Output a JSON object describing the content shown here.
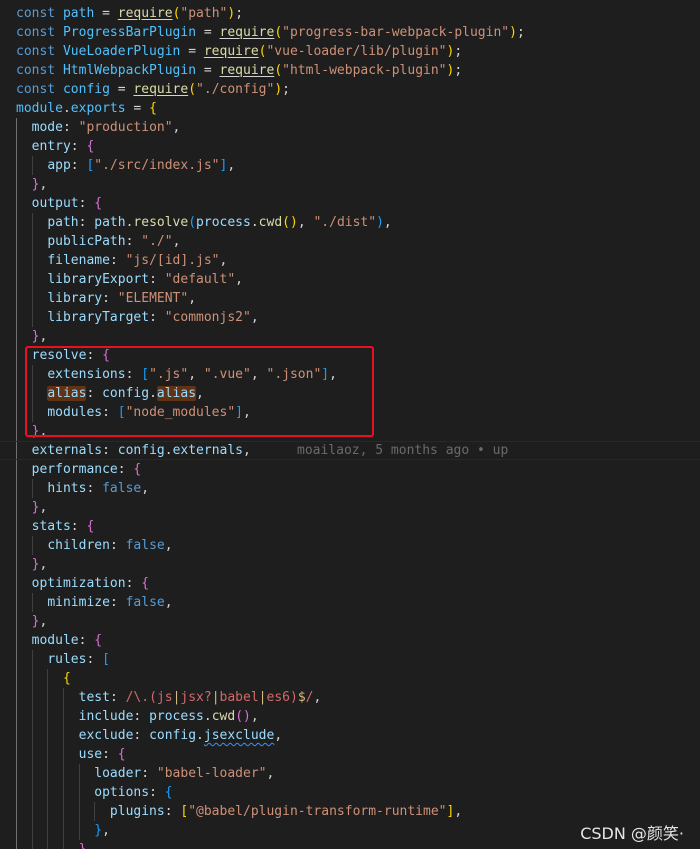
{
  "editor": {
    "lines": [
      [
        [
          "kw",
          "const"
        ],
        [
          "punc",
          " "
        ],
        [
          "var",
          "path"
        ],
        [
          "punc",
          " = "
        ],
        [
          "fnu",
          "require"
        ],
        [
          "b1",
          "("
        ],
        [
          "str",
          "\"path\""
        ],
        [
          "b1",
          ")"
        ],
        [
          "punc",
          ";"
        ]
      ],
      [
        [
          "kw",
          "const"
        ],
        [
          "punc",
          " "
        ],
        [
          "var",
          "ProgressBarPlugin"
        ],
        [
          "punc",
          " = "
        ],
        [
          "fnu",
          "require"
        ],
        [
          "b1",
          "("
        ],
        [
          "str",
          "\"progress-bar-webpack-plugin\""
        ],
        [
          "b1",
          ")"
        ],
        [
          "punc",
          ";"
        ]
      ],
      [
        [
          "kw",
          "const"
        ],
        [
          "punc",
          " "
        ],
        [
          "var",
          "VueLoaderPlugin"
        ],
        [
          "punc",
          " = "
        ],
        [
          "fnu",
          "require"
        ],
        [
          "b1",
          "("
        ],
        [
          "str",
          "\"vue-loader/lib/plugin\""
        ],
        [
          "b1",
          ")"
        ],
        [
          "punc",
          ";"
        ]
      ],
      [
        [
          "kw",
          "const"
        ],
        [
          "punc",
          " "
        ],
        [
          "var",
          "HtmlWebpackPlugin"
        ],
        [
          "punc",
          " = "
        ],
        [
          "fnu",
          "require"
        ],
        [
          "b1",
          "("
        ],
        [
          "str",
          "\"html-webpack-plugin\""
        ],
        [
          "b1",
          ")"
        ],
        [
          "punc",
          ";"
        ]
      ],
      [
        [
          "kw",
          "const"
        ],
        [
          "punc",
          " "
        ],
        [
          "var",
          "config"
        ],
        [
          "punc",
          " = "
        ],
        [
          "fnu",
          "require"
        ],
        [
          "b1",
          "("
        ],
        [
          "str",
          "\"./config\""
        ],
        [
          "b1",
          ")"
        ],
        [
          "punc",
          ";"
        ]
      ],
      [
        [
          "var",
          "module"
        ],
        [
          "punc",
          "."
        ],
        [
          "var",
          "exports"
        ],
        [
          "punc",
          " = "
        ],
        [
          "b1",
          "{"
        ]
      ],
      [
        [
          "punc",
          "  "
        ],
        [
          "prop",
          "mode"
        ],
        [
          "punc",
          ": "
        ],
        [
          "str",
          "\"production\""
        ],
        [
          "punc",
          ","
        ]
      ],
      [
        [
          "punc",
          "  "
        ],
        [
          "prop",
          "entry"
        ],
        [
          "punc",
          ": "
        ],
        [
          "b2",
          "{"
        ]
      ],
      [
        [
          "punc",
          "    "
        ],
        [
          "prop",
          "app"
        ],
        [
          "punc",
          ": "
        ],
        [
          "b3",
          "["
        ],
        [
          "str",
          "\"./src/index.js\""
        ],
        [
          "b3",
          "]"
        ],
        [
          "punc",
          ","
        ]
      ],
      [
        [
          "punc",
          "  "
        ],
        [
          "b2",
          "}"
        ],
        [
          "punc",
          ","
        ]
      ],
      [
        [
          "punc",
          "  "
        ],
        [
          "prop",
          "output"
        ],
        [
          "punc",
          ": "
        ],
        [
          "b2",
          "{"
        ]
      ],
      [
        [
          "punc",
          "    "
        ],
        [
          "prop",
          "path"
        ],
        [
          "punc",
          ": "
        ],
        [
          "prop",
          "path"
        ],
        [
          "punc",
          "."
        ],
        [
          "fn",
          "resolve"
        ],
        [
          "b3",
          "("
        ],
        [
          "prop",
          "process"
        ],
        [
          "punc",
          "."
        ],
        [
          "fn",
          "cwd"
        ],
        [
          "b1",
          "()"
        ],
        [
          "punc",
          ", "
        ],
        [
          "str",
          "\"./dist\""
        ],
        [
          "b3",
          ")"
        ],
        [
          "punc",
          ","
        ]
      ],
      [
        [
          "punc",
          "    "
        ],
        [
          "prop",
          "publicPath"
        ],
        [
          "punc",
          ": "
        ],
        [
          "str",
          "\"./\""
        ],
        [
          "punc",
          ","
        ]
      ],
      [
        [
          "punc",
          "    "
        ],
        [
          "prop",
          "filename"
        ],
        [
          "punc",
          ": "
        ],
        [
          "str",
          "\"js/[id].js\""
        ],
        [
          "punc",
          ","
        ]
      ],
      [
        [
          "punc",
          "    "
        ],
        [
          "prop",
          "libraryExport"
        ],
        [
          "punc",
          ": "
        ],
        [
          "str",
          "\"default\""
        ],
        [
          "punc",
          ","
        ]
      ],
      [
        [
          "punc",
          "    "
        ],
        [
          "prop",
          "library"
        ],
        [
          "punc",
          ": "
        ],
        [
          "str",
          "\"ELEMENT\""
        ],
        [
          "punc",
          ","
        ]
      ],
      [
        [
          "punc",
          "    "
        ],
        [
          "prop",
          "libraryTarget"
        ],
        [
          "punc",
          ": "
        ],
        [
          "str",
          "\"commonjs2\""
        ],
        [
          "punc",
          ","
        ]
      ],
      [
        [
          "punc",
          "  "
        ],
        [
          "b2",
          "}"
        ],
        [
          "punc",
          ","
        ]
      ],
      [
        [
          "punc",
          "  "
        ],
        [
          "prop",
          "resolve"
        ],
        [
          "punc",
          ": "
        ],
        [
          "b2",
          "{"
        ]
      ],
      [
        [
          "punc",
          "    "
        ],
        [
          "prop",
          "extensions"
        ],
        [
          "punc",
          ": "
        ],
        [
          "b3",
          "["
        ],
        [
          "str",
          "\".js\""
        ],
        [
          "punc",
          ", "
        ],
        [
          "str",
          "\".vue\""
        ],
        [
          "punc",
          ", "
        ],
        [
          "str",
          "\".json\""
        ],
        [
          "b3",
          "]"
        ],
        [
          "punc",
          ","
        ]
      ],
      [
        [
          "punc",
          "    "
        ],
        [
          "prophl",
          "alias"
        ],
        [
          "punc",
          ": "
        ],
        [
          "prop",
          "config"
        ],
        [
          "punc",
          "."
        ],
        [
          "prophl",
          "alias"
        ],
        [
          "punc",
          ","
        ]
      ],
      [
        [
          "punc",
          "    "
        ],
        [
          "prop",
          "modules"
        ],
        [
          "punc",
          ": "
        ],
        [
          "b3",
          "["
        ],
        [
          "str",
          "\"node_modules\""
        ],
        [
          "b3",
          "]"
        ],
        [
          "punc",
          ","
        ]
      ],
      [
        [
          "punc",
          "  "
        ],
        [
          "b2",
          "}"
        ],
        [
          "punc",
          ","
        ]
      ],
      [
        [
          "punc",
          "  "
        ],
        [
          "prop",
          "externals"
        ],
        [
          "punc",
          ": "
        ],
        [
          "prop",
          "config"
        ],
        [
          "punc",
          "."
        ],
        [
          "prop",
          "externals"
        ],
        [
          "punc",
          ","
        ]
      ],
      [
        [
          "punc",
          "  "
        ],
        [
          "prop",
          "performance"
        ],
        [
          "punc",
          ": "
        ],
        [
          "b2",
          "{"
        ]
      ],
      [
        [
          "punc",
          "    "
        ],
        [
          "prop",
          "hints"
        ],
        [
          "punc",
          ": "
        ],
        [
          "bool",
          "false"
        ],
        [
          "punc",
          ","
        ]
      ],
      [
        [
          "punc",
          "  "
        ],
        [
          "b2",
          "}"
        ],
        [
          "punc",
          ","
        ]
      ],
      [
        [
          "punc",
          "  "
        ],
        [
          "prop",
          "stats"
        ],
        [
          "punc",
          ": "
        ],
        [
          "b2",
          "{"
        ]
      ],
      [
        [
          "punc",
          "    "
        ],
        [
          "prop",
          "children"
        ],
        [
          "punc",
          ": "
        ],
        [
          "bool",
          "false"
        ],
        [
          "punc",
          ","
        ]
      ],
      [
        [
          "punc",
          "  "
        ],
        [
          "b2",
          "}"
        ],
        [
          "punc",
          ","
        ]
      ],
      [
        [
          "punc",
          "  "
        ],
        [
          "prop",
          "optimization"
        ],
        [
          "punc",
          ": "
        ],
        [
          "b2",
          "{"
        ]
      ],
      [
        [
          "punc",
          "    "
        ],
        [
          "prop",
          "minimize"
        ],
        [
          "punc",
          ": "
        ],
        [
          "bool",
          "false"
        ],
        [
          "punc",
          ","
        ]
      ],
      [
        [
          "punc",
          "  "
        ],
        [
          "b2",
          "}"
        ],
        [
          "punc",
          ","
        ]
      ],
      [
        [
          "punc",
          "  "
        ],
        [
          "prop",
          "module"
        ],
        [
          "punc",
          ": "
        ],
        [
          "b2",
          "{"
        ]
      ],
      [
        [
          "punc",
          "    "
        ],
        [
          "prop",
          "rules"
        ],
        [
          "punc",
          ": "
        ],
        [
          "b3",
          "["
        ]
      ],
      [
        [
          "punc",
          "      "
        ],
        [
          "b1",
          "{"
        ]
      ],
      [
        [
          "punc",
          "        "
        ],
        [
          "prop",
          "test"
        ],
        [
          "punc",
          ": "
        ],
        [
          "re",
          "/\\.(js"
        ],
        [
          "rd",
          "|"
        ],
        [
          "re",
          "jsx?"
        ],
        [
          "rd",
          "|"
        ],
        [
          "re",
          "babel"
        ],
        [
          "rd",
          "|"
        ],
        [
          "re",
          "es6)"
        ],
        [
          "rd",
          "$"
        ],
        [
          "re",
          "/"
        ],
        [
          "punc",
          ","
        ]
      ],
      [
        [
          "punc",
          "        "
        ],
        [
          "prop",
          "include"
        ],
        [
          "punc",
          ": "
        ],
        [
          "prop",
          "process"
        ],
        [
          "punc",
          "."
        ],
        [
          "fn",
          "cwd"
        ],
        [
          "b2",
          "()"
        ],
        [
          "punc",
          ","
        ]
      ],
      [
        [
          "punc",
          "        "
        ],
        [
          "prop",
          "exclude"
        ],
        [
          "punc",
          ": "
        ],
        [
          "prop",
          "config"
        ],
        [
          "punc",
          "."
        ],
        [
          "propsq",
          "jsexclude"
        ],
        [
          "punc",
          ","
        ]
      ],
      [
        [
          "punc",
          "        "
        ],
        [
          "prop",
          "use"
        ],
        [
          "punc",
          ": "
        ],
        [
          "b2",
          "{"
        ]
      ],
      [
        [
          "punc",
          "          "
        ],
        [
          "prop",
          "loader"
        ],
        [
          "punc",
          ": "
        ],
        [
          "str",
          "\"babel-loader\""
        ],
        [
          "punc",
          ","
        ]
      ],
      [
        [
          "punc",
          "          "
        ],
        [
          "prop",
          "options"
        ],
        [
          "punc",
          ": "
        ],
        [
          "b3",
          "{"
        ]
      ],
      [
        [
          "punc",
          "            "
        ],
        [
          "prop",
          "plugins"
        ],
        [
          "punc",
          ": "
        ],
        [
          "b1",
          "["
        ],
        [
          "str",
          "\"@babel/plugin-transform-runtime\""
        ],
        [
          "b1",
          "]"
        ],
        [
          "punc",
          ","
        ]
      ],
      [
        [
          "punc",
          "          "
        ],
        [
          "b3",
          "}"
        ],
        [
          "punc",
          ","
        ]
      ],
      [
        [
          "punc",
          "        "
        ],
        [
          "b2",
          "}"
        ],
        [
          "punc",
          ","
        ]
      ]
    ]
  },
  "blame": "moailaoz, 5 months ago • up",
  "watermark": "CSDN @颜笑·"
}
